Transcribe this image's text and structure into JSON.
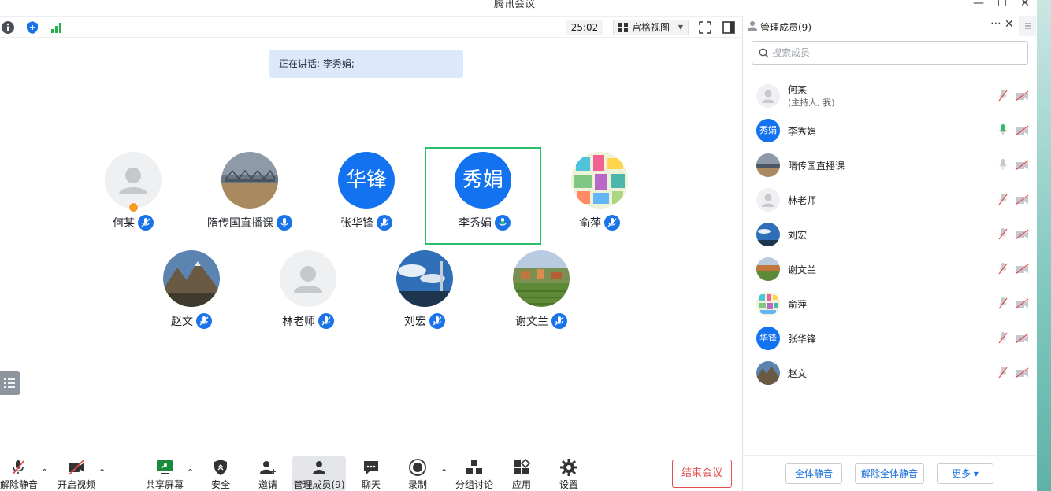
{
  "window": {
    "title": "腾讯会议",
    "min": "—",
    "max": "☐",
    "close": "✕"
  },
  "topbar": {
    "timer": "25:02",
    "view_label": "宫格视图"
  },
  "speaking": "正在讲话: 李秀娟;",
  "tiles": [
    {
      "name": "何某",
      "avatar_text": "",
      "mic": "off",
      "host": true
    },
    {
      "name": "隋传国直播课",
      "avatar_text": "",
      "mic": "on"
    },
    {
      "name": "张华锋",
      "avatar_text": "华锋",
      "mic": "off"
    },
    {
      "name": "李秀娟",
      "avatar_text": "秀娟",
      "mic": "speaking",
      "active": true
    },
    {
      "name": "俞萍",
      "avatar_text": "",
      "mic": "off"
    },
    {
      "name": "赵文",
      "avatar_text": "",
      "mic": "off"
    },
    {
      "name": "林老师",
      "avatar_text": "",
      "mic": "off"
    },
    {
      "name": "刘宏",
      "avatar_text": "",
      "mic": "off"
    },
    {
      "name": "谢文兰",
      "avatar_text": "",
      "mic": "off"
    }
  ],
  "toolbar": {
    "unmute": "解除静音",
    "start_video": "开启视频",
    "share_screen": "共享屏幕",
    "security": "安全",
    "invite": "邀请",
    "manage_members": "管理成员(9)",
    "chat": "聊天",
    "record": "录制",
    "breakout": "分组讨论",
    "apps": "应用",
    "settings": "设置",
    "end_meeting": "结束会议"
  },
  "panel": {
    "title": "管理成员(9)",
    "more": "⋯",
    "close": "✕",
    "search_placeholder": "搜索成员",
    "members": [
      {
        "name": "何某",
        "sub": "(主持人, 我)",
        "avatar_text": "",
        "mic": "muted"
      },
      {
        "name": "李秀娟",
        "avatar_text": "秀娟",
        "mic": "speaking"
      },
      {
        "name": "隋传国直播课",
        "avatar_text": "",
        "mic": "on"
      },
      {
        "name": "林老师",
        "avatar_text": "",
        "mic": "muted"
      },
      {
        "name": "刘宏",
        "avatar_text": "",
        "mic": "muted"
      },
      {
        "name": "谢文兰",
        "avatar_text": "",
        "mic": "muted"
      },
      {
        "name": "俞萍",
        "avatar_text": "",
        "mic": "muted"
      },
      {
        "name": "张华锋",
        "avatar_text": "华锋",
        "mic": "muted"
      },
      {
        "name": "赵文",
        "avatar_text": "",
        "mic": "muted"
      }
    ],
    "mute_all": "全体静音",
    "unmute_all": "解除全体静音",
    "more_btn": "更多 ▾"
  },
  "colors": {
    "accent": "#1a73e8",
    "speaking": "#2bbf6a",
    "danger": "#e34d4d"
  }
}
